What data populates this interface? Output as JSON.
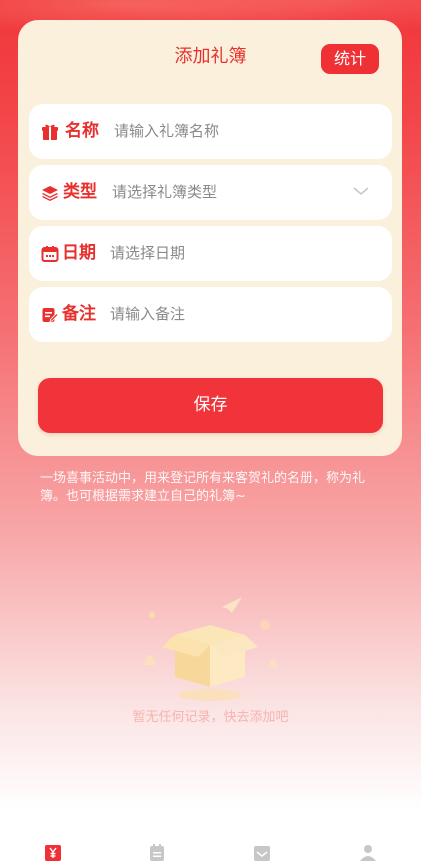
{
  "form": {
    "title": "添加礼簿",
    "stats_label": "统计",
    "fields": [
      {
        "label": "名称",
        "value": "请输入礼簿名称",
        "icon": "gift-icon"
      },
      {
        "label": "类型",
        "value": "请选择礼簿类型",
        "icon": "layers-icon"
      },
      {
        "label": "日期",
        "value": "请选择日期",
        "icon": "calendar-icon"
      },
      {
        "label": "备注",
        "value": "请输入备注",
        "icon": "note-edit-icon"
      }
    ],
    "save_label": "保存"
  },
  "description": "一场喜事活动中，用来登记所有来客贺礼的名册，称为礼簿。也可根据需求建立自己的礼簿~",
  "empty_state": {
    "text": "暂无任何记录，快去添加吧",
    "icon": "empty-box-illustration"
  },
  "tabbar": {
    "tabs": [
      {
        "icon": "ledger-yuan-icon",
        "active": true
      },
      {
        "icon": "calendar-list-icon",
        "active": false
      },
      {
        "icon": "inbox-icon",
        "active": false
      },
      {
        "icon": "user-icon",
        "active": false
      }
    ]
  },
  "colors": {
    "accent": "#ef3034",
    "card_bg": "#fbf0dc",
    "label_red": "#e8312f",
    "placeholder_gray": "#8a8a8a"
  }
}
